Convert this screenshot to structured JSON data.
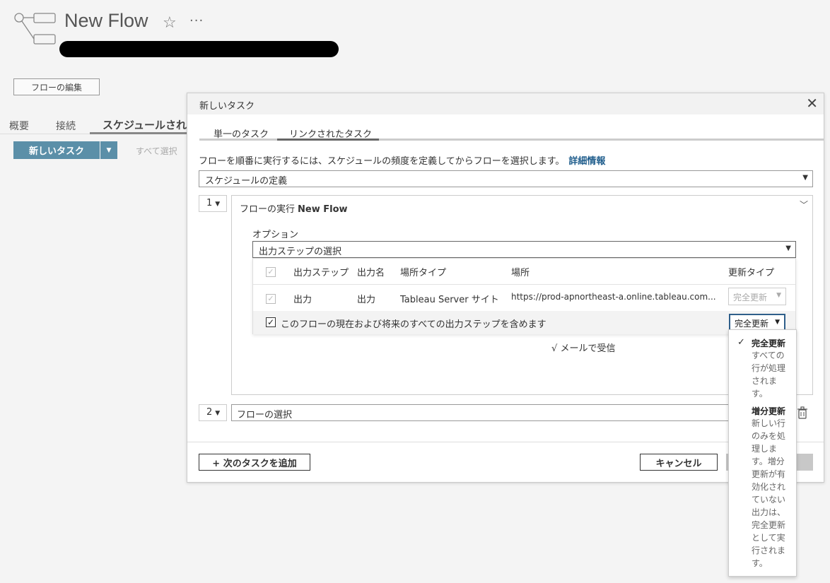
{
  "page": {
    "title": "New Flow",
    "edit_flow_button": "フローの編集",
    "tabs": [
      "概要",
      "接続",
      "スケジュールされ"
    ],
    "new_task_button": "新しいタスク",
    "select_all": "すべて選択"
  },
  "dialog": {
    "title": "新しいタスク",
    "tabs": [
      "単一のタスク",
      "リンクされたタスク"
    ],
    "intro_text": "フローを順番に実行するには、スケジュールの頻度を定義してからフローを選択します。",
    "intro_link": "詳細情報",
    "schedule_select": "スケジュールの定義",
    "task1": {
      "number": "1",
      "header_label": "フローの実行",
      "flow_name": "New Flow",
      "options_label": "オプション",
      "output_select": "出力ステップの選択",
      "table_headers": [
        "出力ステップ",
        "出力名",
        "場所タイプ",
        "場所",
        "更新タイプ"
      ],
      "row": {
        "step": "出力",
        "name": "出力",
        "location_type": "Tableau Server サイト",
        "location": "https://prod-apnortheast-a.online.tableau.com...",
        "refresh_type": "完全更新"
      },
      "include_all_text": "このフローの現在および将来のすべての出力ステップを含めます",
      "include_refresh_type": "完全更新",
      "email_label": "メールで受信"
    },
    "task2": {
      "number": "2",
      "flow_select": "フローの選択"
    },
    "add_task_button": "+ 次のタスクを追加",
    "cancel_button": "キャンセル"
  },
  "refresh_menu": {
    "check": "✓",
    "items": [
      {
        "title": "完全更新",
        "desc": "すべての行が処理されます。"
      },
      {
        "title": "増分更新",
        "desc": "新しい行のみを処理します。増分更新が有効化されていない出力は、完全更新として実行されます。"
      }
    ]
  },
  "icons": {
    "star": "☆",
    "more": "···",
    "close": "✕",
    "caret": "▼",
    "chevron": "﹀",
    "check": "✓",
    "mail_check": "√"
  }
}
